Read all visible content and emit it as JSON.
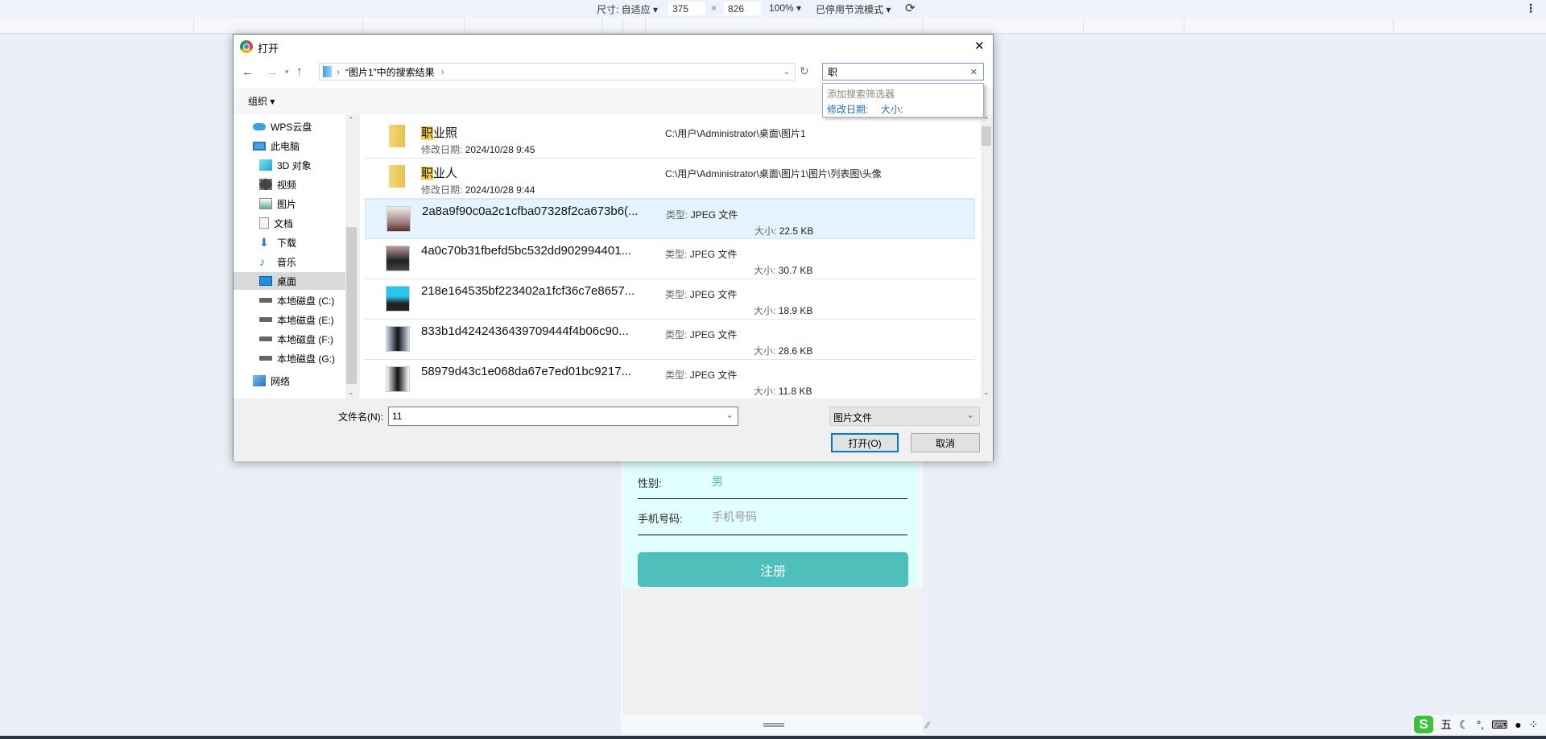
{
  "devtools": {
    "size_label": "尺寸: 自适应 ▾",
    "width": "375",
    "times": "×",
    "height": "826",
    "zoom": "100% ▾",
    "throttle": "已停用节流模式 ▾",
    "menu": "⋮"
  },
  "page": {
    "gender_label": "性别:",
    "gender_value": "男",
    "phone_label": "手机号码:",
    "phone_placeholder": "手机号码",
    "register_button": "注册",
    "accent": "#4fbfbc"
  },
  "dialog": {
    "title": "打开",
    "close": "✕",
    "breadcrumb": "“图片1”中的搜索结果",
    "search_value": "职",
    "search_clear": "✕",
    "filter_hint": "添加搜索筛选器",
    "filter_date": "修改日期:",
    "filter_size": "大小:",
    "organize": "组织 ▾",
    "sidebar": [
      {
        "label": "WPS云盘",
        "icon": "cloud-icon"
      },
      {
        "label": "此电脑",
        "icon": "computer-icon"
      },
      {
        "label": "3D 对象",
        "icon": "cube-icon"
      },
      {
        "label": "视频",
        "icon": "video-icon"
      },
      {
        "label": "图片",
        "icon": "picture-icon"
      },
      {
        "label": "文档",
        "icon": "document-icon"
      },
      {
        "label": "下载",
        "icon": "download-icon"
      },
      {
        "label": "音乐",
        "icon": "music-icon"
      },
      {
        "label": "桌面",
        "icon": "desktop-icon"
      },
      {
        "label": "本地磁盘 (C:)",
        "icon": "drive-icon"
      },
      {
        "label": "本地磁盘 (E:)",
        "icon": "drive-icon"
      },
      {
        "label": "本地磁盘 (F:)",
        "icon": "drive-icon"
      },
      {
        "label": "本地磁盘 (G:)",
        "icon": "drive-icon"
      },
      {
        "label": "网络",
        "icon": "network-icon"
      }
    ],
    "folders": [
      {
        "hl": "职",
        "rest": "业照",
        "date_label": "修改日期:",
        "date": "2024/10/28 9:45",
        "path": "C:\\用户\\Administrator\\桌面\\图片1"
      },
      {
        "hl": "职",
        "rest": "业人",
        "date_label": "修改日期:",
        "date": "2024/10/28 9:44",
        "path": "C:\\用户\\Administrator\\桌面\\图片1\\图片\\列表图\\头像"
      }
    ],
    "files": [
      {
        "name": "2a8a9f90c0a2c1cfba07328f2ca673b6(...",
        "type_label": "类型:",
        "type": "JPEG 文件",
        "size_label": "大小:",
        "size": "22.5 KB"
      },
      {
        "name": "4a0c70b31fbefd5bc532dd902994401...",
        "type_label": "类型:",
        "type": "JPEG 文件",
        "size_label": "大小:",
        "size": "30.7 KB"
      },
      {
        "name": "218e164535bf223402a1fcf36c7e8657...",
        "type_label": "类型:",
        "type": "JPEG 文件",
        "size_label": "大小:",
        "size": "18.9 KB"
      },
      {
        "name": "833b1d4242436439709444f4b06c90...",
        "type_label": "类型:",
        "type": "JPEG 文件",
        "size_label": "大小:",
        "size": "28.6 KB"
      },
      {
        "name": "58979d43c1e068da67e7ed01bc9217...",
        "type_label": "类型:",
        "type": "JPEG 文件",
        "size_label": "大小:",
        "size": "11.8 KB"
      }
    ],
    "filename_label": "文件名(N):",
    "filename_value": "11",
    "filetype": "图片文件",
    "open_button": "打开(O)",
    "cancel_button": "取消"
  },
  "ime": {
    "mode": "五"
  }
}
